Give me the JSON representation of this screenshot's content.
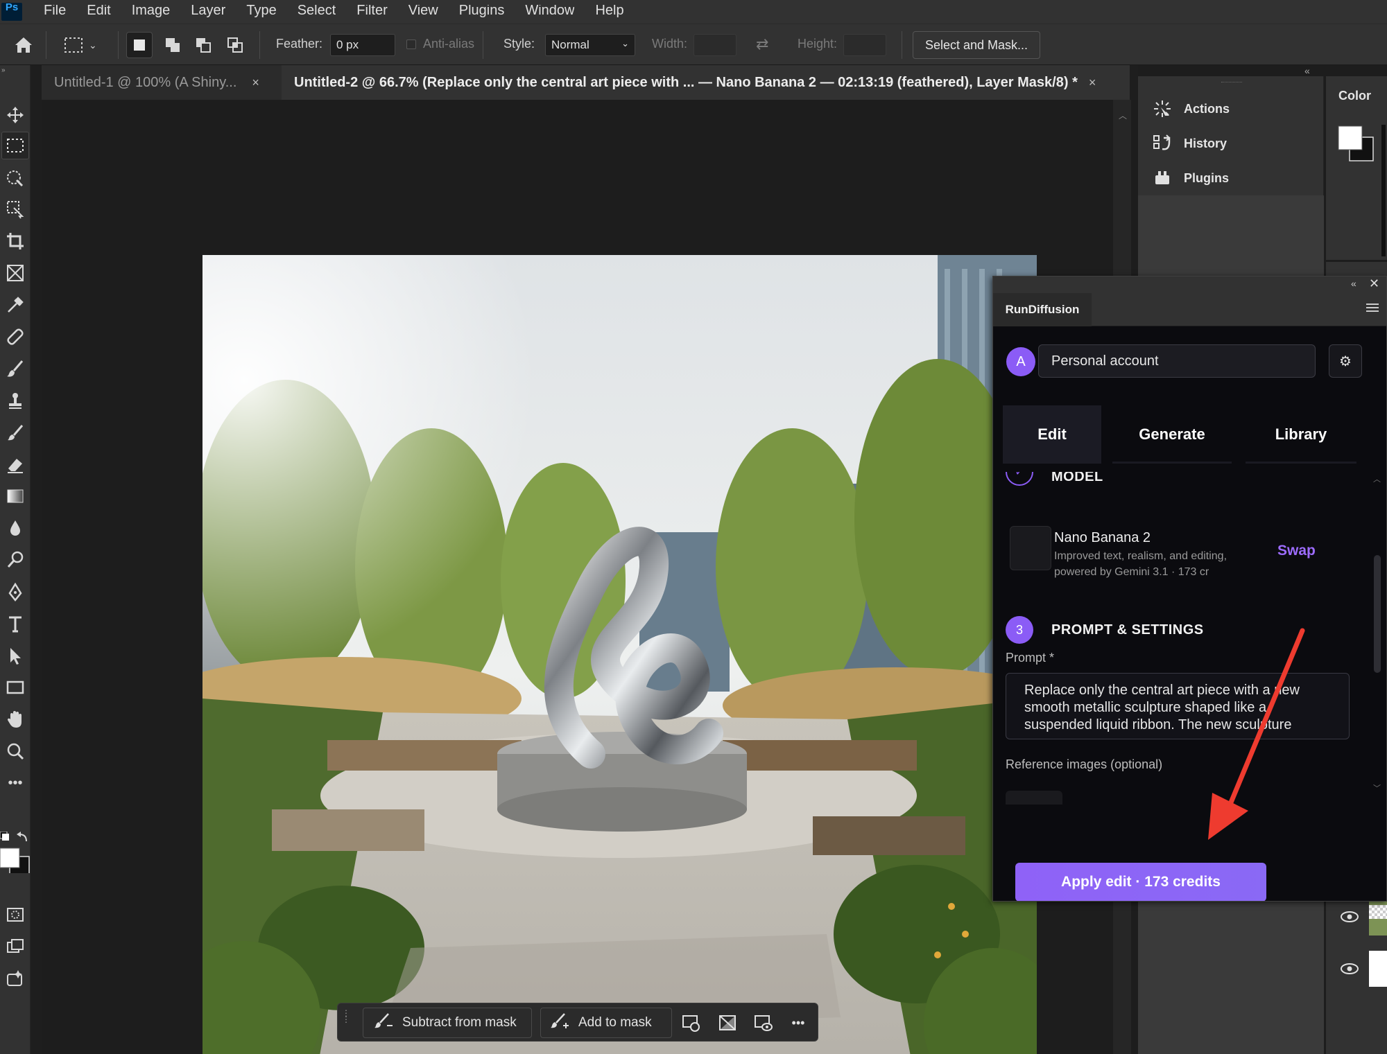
{
  "menubar": {
    "logo": "Ps",
    "items": [
      "File",
      "Edit",
      "Image",
      "Layer",
      "Type",
      "Select",
      "Filter",
      "View",
      "Plugins",
      "Window",
      "Help"
    ]
  },
  "options": {
    "feather_label": "Feather:",
    "feather_value": "0 px",
    "antialias_label": "Anti-alias",
    "style_label": "Style:",
    "style_value": "Normal",
    "width_label": "Width:",
    "height_label": "Height:",
    "select_mask_label": "Select and Mask..."
  },
  "tabs": [
    {
      "label": "Untitled-1 @ 100% (A Shiny...",
      "close": "×"
    },
    {
      "label": "Untitled-2 @ 66.7% (Replace only the central art piece with ... — Nano Banana 2 — 02:13:19 (feathered), Layer Mask/8) *",
      "close": "×"
    }
  ],
  "panels": {
    "actions": "Actions",
    "history": "History",
    "plugins": "Plugins",
    "color": "Color"
  },
  "rundiffusion": {
    "title": "RunDiffusion",
    "avatar_letter": "A",
    "account": "Personal account",
    "tabs": [
      "Edit",
      "Generate",
      "Library"
    ],
    "model_section_title": "MODEL",
    "model_name": "Nano Banana 2",
    "model_desc": "Improved text, realism, and editing, powered by Gemini 3.1 · 173 cr",
    "swap": "Swap",
    "step3_num": "3",
    "step3_title": "PROMPT & SETTINGS",
    "prompt_label": "Prompt *",
    "prompt_value": "Replace only the central art piece with a new smooth metallic sculpture shaped like a suspended liquid ribbon. The new sculpture",
    "ref_label": "Reference images (optional)",
    "apply_label": "Apply edit · 173 credits"
  },
  "contextbar": {
    "subtract": "Subtract from mask",
    "add": "Add to mask",
    "more": "•••"
  },
  "colors": {
    "accent": "#8b5cf6",
    "swap": "#9d6cff",
    "annotation_arrow": "#ee3b2f"
  }
}
